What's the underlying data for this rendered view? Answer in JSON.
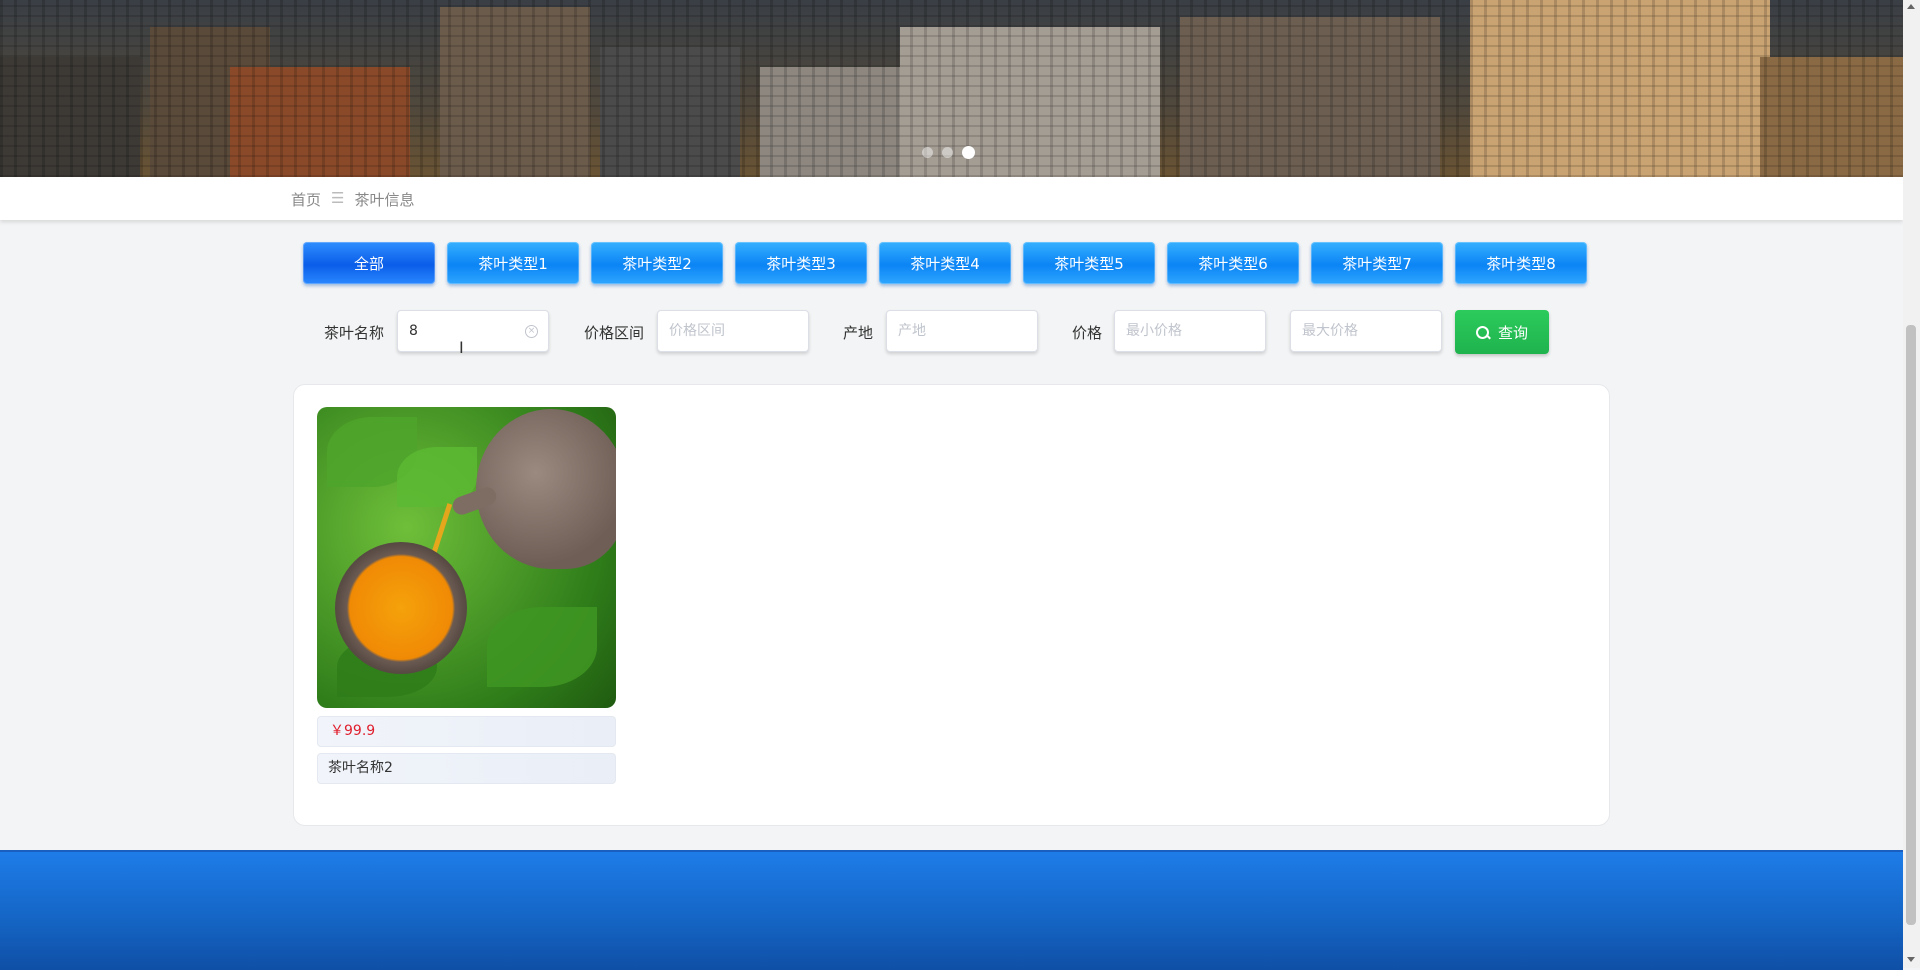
{
  "carousel": {
    "dot_count": 3,
    "active_index": 2
  },
  "breadcrumb": {
    "home": "首页",
    "separator": "☰",
    "current": "茶叶信息"
  },
  "tabs": [
    {
      "label": "全部",
      "active": true
    },
    {
      "label": "茶叶类型1"
    },
    {
      "label": "茶叶类型2"
    },
    {
      "label": "茶叶类型3"
    },
    {
      "label": "茶叶类型4"
    },
    {
      "label": "茶叶类型5"
    },
    {
      "label": "茶叶类型6"
    },
    {
      "label": "茶叶类型7"
    },
    {
      "label": "茶叶类型8"
    }
  ],
  "search": {
    "name_label": "茶叶名称",
    "name_value": "8",
    "price_range_label": "价格区间",
    "price_range_placeholder": "价格区间",
    "origin_label": "产地",
    "origin_placeholder": "产地",
    "price_label": "价格",
    "min_price_placeholder": "最小价格",
    "max_price_placeholder": "最大价格",
    "query_label": "查询"
  },
  "products": [
    {
      "price": "￥99.9",
      "name": "茶叶名称2"
    }
  ],
  "colors": {
    "tab_blue": "#0b84f5",
    "query_green": "#22c55e",
    "price_red": "#e0202e",
    "footer_blue": "#1566c6"
  }
}
